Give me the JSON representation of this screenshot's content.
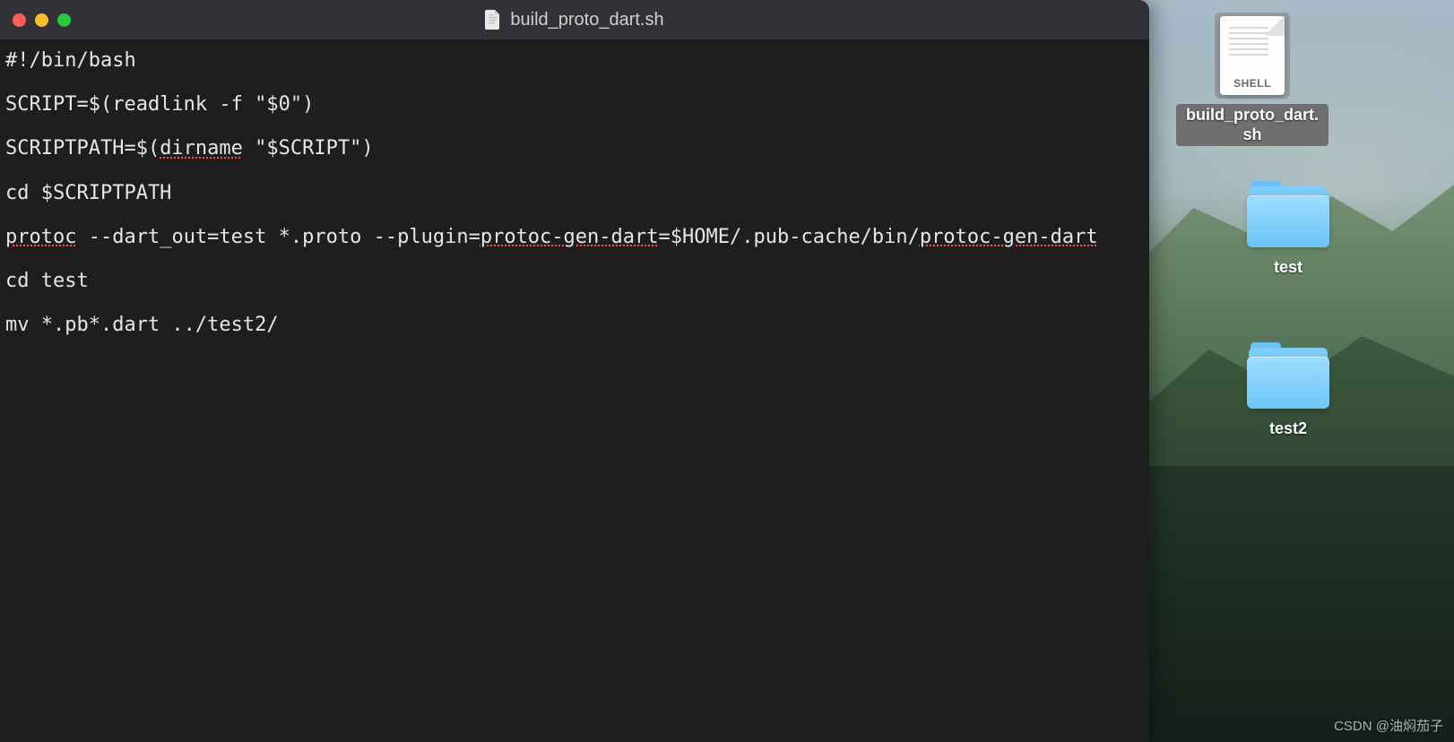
{
  "window": {
    "title": "build_proto_dart.sh"
  },
  "code": {
    "lines": [
      {
        "plain": "#!/bin/bash"
      },
      {
        "plain": ""
      },
      {
        "plain": "SCRIPT=$(readlink -f \"$0\")"
      },
      {
        "plain": ""
      },
      {
        "segs": [
          {
            "t": "SCRIPTPATH=$("
          },
          {
            "t": "dirname",
            "err": true
          },
          {
            "t": " \"$SCRIPT\")"
          }
        ]
      },
      {
        "plain": ""
      },
      {
        "plain": "cd $SCRIPTPATH"
      },
      {
        "plain": ""
      },
      {
        "segs": [
          {
            "t": "protoc",
            "err": true
          },
          {
            "t": " --dart_out=test *.proto --plugin="
          },
          {
            "t": "protoc-gen-dart",
            "err": true
          },
          {
            "t": "=$HOME/.pub-cache/bin/"
          },
          {
            "t": "protoc-gen-dart",
            "err": true
          }
        ]
      },
      {
        "plain": ""
      },
      {
        "plain": "cd test"
      },
      {
        "plain": ""
      },
      {
        "plain": "mv *.pb*.dart ../test2/"
      }
    ]
  },
  "desktop": {
    "file": {
      "label": "build_proto_dart.sh",
      "tag": "SHELL"
    },
    "folder1": {
      "label": "test"
    },
    "folder2": {
      "label": "test2"
    }
  },
  "watermark": "CSDN @油焖茄子"
}
